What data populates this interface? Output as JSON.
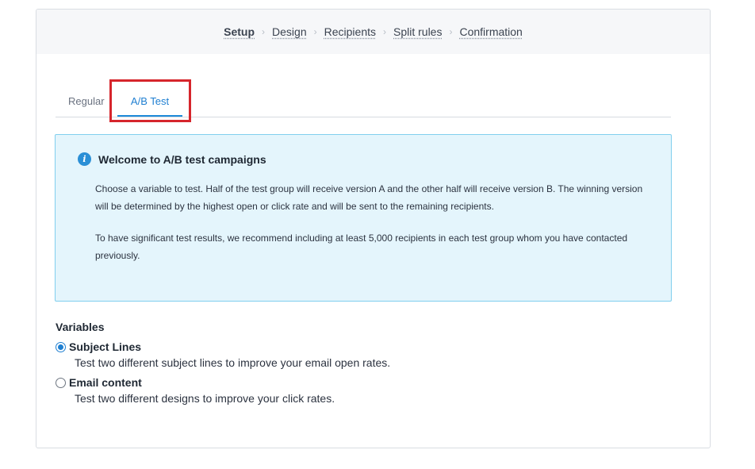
{
  "wizard": {
    "steps": [
      {
        "label": "Setup",
        "current": true
      },
      {
        "label": "Design",
        "current": false
      },
      {
        "label": "Recipients",
        "current": false
      },
      {
        "label": "Split rules",
        "current": false
      },
      {
        "label": "Confirmation",
        "current": false
      }
    ],
    "separator": "›"
  },
  "tabs": {
    "regular": "Regular",
    "ab_test": "A/B Test",
    "active": "ab_test"
  },
  "info": {
    "icon": "info-icon",
    "title": "Welcome to A/B test campaigns",
    "paragraph1": "Choose a variable to test. Half of the test group will receive version A and the other half will receive version B. The winning version will be determined by the highest open or click rate and will be sent to the remaining recipients.",
    "paragraph2": "To have significant test results, we recommend including at least 5,000 recipients in each test group whom you have contacted previously."
  },
  "variables": {
    "title": "Variables",
    "options": [
      {
        "label": "Subject Lines",
        "description": "Test two different subject lines to improve your email open rates.",
        "selected": true
      },
      {
        "label": "Email content",
        "description": "Test two different designs to improve your click rates.",
        "selected": false
      }
    ]
  },
  "colors": {
    "accent": "#1f7fd1",
    "highlight": "#d6252c",
    "info_bg": "#e4f5fc",
    "info_border": "#81cfee"
  }
}
